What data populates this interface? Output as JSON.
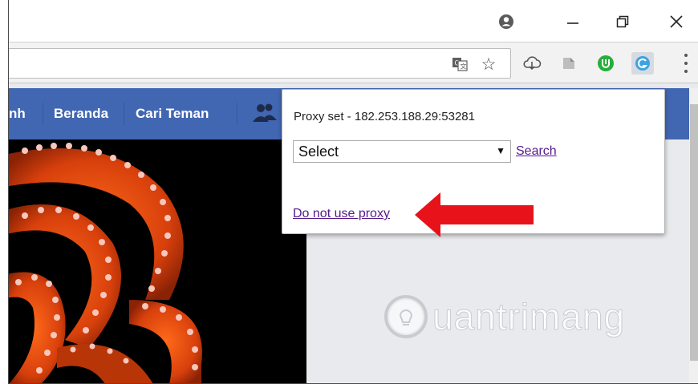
{
  "popup": {
    "status_text": "Proxy set - 182.253.188.29:53281",
    "select_value": "Select",
    "select_arrow": "▼",
    "search_link": "Search",
    "no_proxy_link": "Do not use proxy"
  },
  "navbar": {
    "items": [
      "nh",
      "Beranda",
      "Cari Teman"
    ]
  },
  "watermark": {
    "text": "uantrimang"
  },
  "toolbar": {
    "star_icon": "☆"
  },
  "colors": {
    "nav_bg": "#4267b2",
    "link": "#551a8b",
    "arrow": "#e8121b",
    "extension_green": "#27ae3b",
    "extension_proxy": "#3da3e0"
  },
  "icons": [
    "profile-icon",
    "minimize-icon",
    "restore-icon",
    "close-icon",
    "translate-icon",
    "star-icon",
    "cloud-extension-icon",
    "gray-extension-icon",
    "green-extension-icon",
    "proxy-extension-icon",
    "menu-icon",
    "friends-icon",
    "red-arrow-icon",
    "lightbulb-icon"
  ]
}
